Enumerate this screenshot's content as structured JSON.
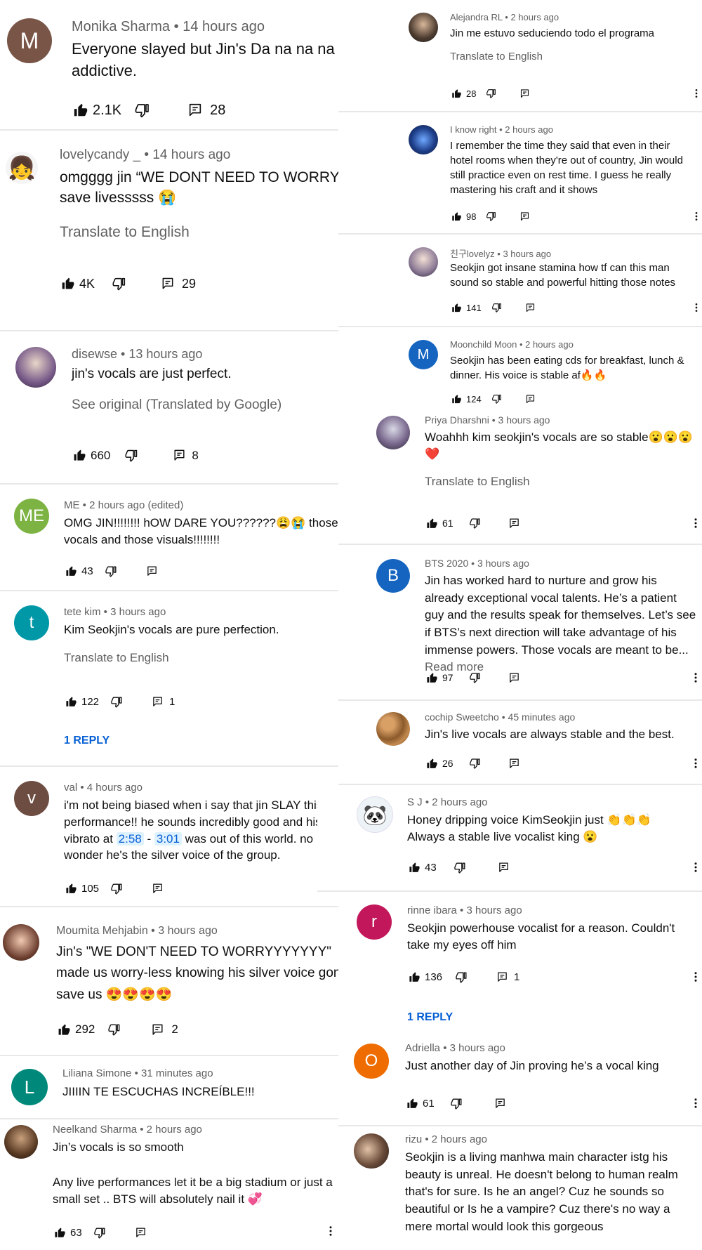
{
  "left": [
    {
      "author": "Monika Sharma",
      "time": "14 hours ago",
      "text": "Everyone slayed but Jin's Da na na na is so addictive.",
      "likes": "2.1K",
      "replies": "28",
      "avatar_letter": "M",
      "avatar_color": "#795548"
    },
    {
      "author": "lovelycandy _",
      "time": "14 hours ago",
      "text": "omgggg jin “WE DONT NEED TO WORRYYY” save livesssss 😭",
      "translate": "Translate to English",
      "likes": "4K",
      "replies": "29"
    },
    {
      "author": "disewse",
      "time": "13 hours ago",
      "text": "jin's vocals are just perfect.",
      "translate": "See original (Translated by Google)",
      "likes": "660",
      "replies": "8"
    },
    {
      "author": "ME",
      "time": "2 hours ago (edited)",
      "text": "OMG JIN!!!!!!!! hOW DARE YOU??????😩😭 those vocals and those visuals!!!!!!!!",
      "likes": "43",
      "avatar_letter": "ME",
      "avatar_color": "#7cb342"
    },
    {
      "author": "tete kim",
      "time": "3 hours ago",
      "text": "Kim Seokjin's vocals are pure perfection.",
      "translate": "Translate to English",
      "likes": "122",
      "replies": "1",
      "reply_link": "1 REPLY",
      "avatar_letter": "t",
      "avatar_color": "#0097a7"
    },
    {
      "author": "val",
      "time": "4 hours ago",
      "text_a": "i'm not being biased when i say that jin SLAY this performance!! he sounds incredibly good and his vibrato at ",
      "ts1": "2:58",
      "dash": " - ",
      "ts2": "3:01",
      "text_b": " was out of this world. no wonder he's the silver voice of the group.",
      "likes": "105",
      "avatar_letter": "v",
      "avatar_color": "#6d4c41"
    },
    {
      "author": "Moumita Mehjabin",
      "time": "3 hours ago",
      "text": "Jin's \"WE DON'T NEED TO WORRYYYYYYY\" made us worry-less knowing his silver voice gonna save us 😍😍😍😍",
      "likes": "292",
      "replies": "2"
    },
    {
      "author": "Liliana Simone",
      "time": "31 minutes ago",
      "text": "JIIIIN TE ESCUCHAS INCREÍBLE!!!",
      "avatar_letter": "L",
      "avatar_color": "#00897b"
    },
    {
      "author": "Neelkand Sharma",
      "time": "2 hours ago",
      "text": "Jin’s vocals is so smooth",
      "text2": "Any live performances let it be a big stadium or just a small set .. BTS will absolutely nail it 💞",
      "likes": "63"
    }
  ],
  "right": [
    {
      "author": "Alejandra RL",
      "time": "2 hours ago",
      "text": "Jin me estuvo seduciendo todo el programa",
      "translate": "Translate to English",
      "likes": "28"
    },
    {
      "author": "I know right",
      "time": "2 hours ago",
      "text": "I remember the time they said that even in their hotel rooms when they're out of country, Jin would still practice even on rest time. I guess he really mastering his craft and it shows",
      "likes": "98"
    },
    {
      "author": "친구lovelyz",
      "time": "3 hours ago",
      "text": "Seokjin got insane stamina how tf can this man sound so stable and powerful hitting those notes",
      "likes": "141"
    },
    {
      "author": "Moonchild Moon",
      "time": "2 hours ago",
      "text": "Seokjin has been eating cds for breakfast, lunch & dinner. His voice is stable af🔥🔥",
      "likes": "124",
      "avatar_letter": "M",
      "avatar_color": "#1565c0"
    },
    {
      "author": "Priya Dharshni",
      "time": "3 hours ago",
      "text": "Woahhh kim seokjin's vocals are so stable😮😮😮 ❤️",
      "translate": "Translate to English",
      "likes": "61"
    },
    {
      "author": "BTS 2020",
      "time": "3 hours ago",
      "text": "Jin has worked hard to nurture and grow his already exceptional vocal talents. He’s a patient guy and the results speak for themselves. Let’s see if BTS’s next direction will take advantage of his immense powers. Those vocals are meant to be...",
      "read_more": "Read more",
      "likes": "97",
      "avatar_letter": "B",
      "avatar_color": "#1565c0"
    },
    {
      "author": "cochip Sweetcho",
      "time": "45 minutes ago",
      "text": "Jin's live vocals are always stable and the best.",
      "likes": "26"
    },
    {
      "author": "S J",
      "time": "2 hours ago",
      "text": "Honey dripping voice KimSeokjin just 👏👏👏 Always a stable live vocalist king 😮",
      "likes": "43"
    },
    {
      "author": "rinne ibara",
      "time": "3 hours ago",
      "text": "Seokjin powerhouse vocalist for a reason. Couldn't take my eyes off him",
      "likes": "136",
      "replies": "1",
      "reply_link": "1 REPLY",
      "avatar_letter": "r",
      "avatar_color": "#c2185b"
    },
    {
      "author": "Adriella",
      "time": "3 hours ago",
      "text": "Just another day of Jin proving he’s a vocal king",
      "likes": "61",
      "avatar_letter": "O",
      "avatar_color": "#ef6c00"
    },
    {
      "author": "rizu",
      "time": "2 hours ago",
      "text": "Seokjin is a living manhwa main character istg his beauty is unreal. He doesn't belong to human realm that's for sure. Is he an angel? Cuz he sounds so beautiful or Is he a vampire? Cuz there's no way a mere mortal would look this gorgeous"
    }
  ],
  "sep": " • ",
  "icons": {
    "like": "thumbs-up-icon",
    "dislike": "thumbs-down-icon",
    "reply": "reply-icon",
    "more": "more-vert-icon"
  }
}
